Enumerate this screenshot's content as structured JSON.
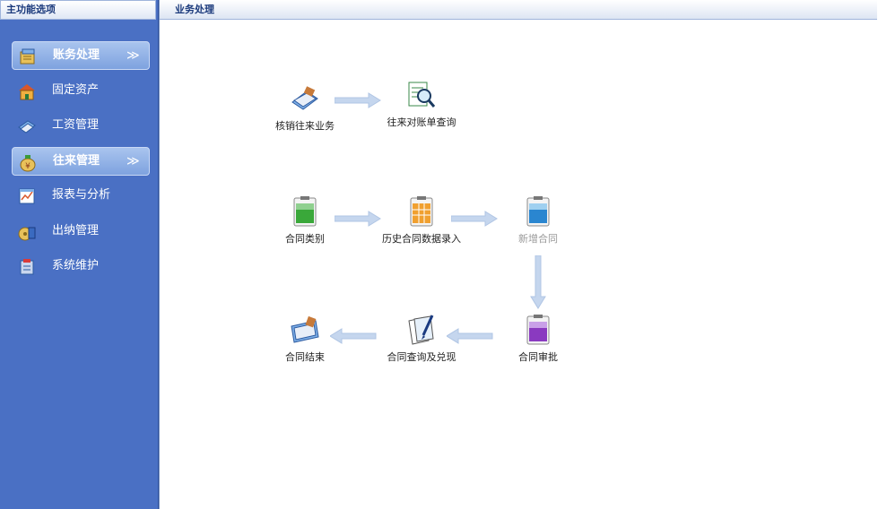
{
  "sidebar": {
    "title": "主功能选项",
    "items": [
      {
        "label": "账务处理",
        "icon": "ledger-icon",
        "active": true
      },
      {
        "label": "固定资产",
        "icon": "building-icon",
        "active": false
      },
      {
        "label": "工资管理",
        "icon": "payroll-icon",
        "active": false
      },
      {
        "label": "往来管理",
        "icon": "money-bag-icon",
        "active": true
      },
      {
        "label": "报表与分析",
        "icon": "report-icon",
        "active": false
      },
      {
        "label": "出纳管理",
        "icon": "cashier-icon",
        "active": false
      },
      {
        "label": "系统维护",
        "icon": "maintenance-icon",
        "active": false
      }
    ],
    "chevron": "≫"
  },
  "main": {
    "title": "业务处理",
    "nodes": {
      "write_off": {
        "label": "核销往来业务",
        "icon": "write-off-icon"
      },
      "statement_query": {
        "label": "往来对账单查询",
        "icon": "magnifier-sheet-icon"
      },
      "contract_category": {
        "label": "合同类别",
        "icon": "green-clipboard-icon"
      },
      "history_entry": {
        "label": "历史合同数据录入",
        "icon": "orange-clipboard-icon"
      },
      "new_contract": {
        "label": "新增合同",
        "icon": "blue-clipboard-icon"
      },
      "contract_approval": {
        "label": "合同审批",
        "icon": "purple-clipboard-icon"
      },
      "contract_query": {
        "label": "合同查询及兑现",
        "icon": "document-pen-icon"
      },
      "contract_end": {
        "label": "合同结束",
        "icon": "contract-end-icon"
      }
    }
  },
  "colors": {
    "sidebar_bg": "#4a70c4",
    "active_item": "#8fb0e6",
    "arrow": "#c5d6ee",
    "disabled_text": "#9a9a9a"
  }
}
